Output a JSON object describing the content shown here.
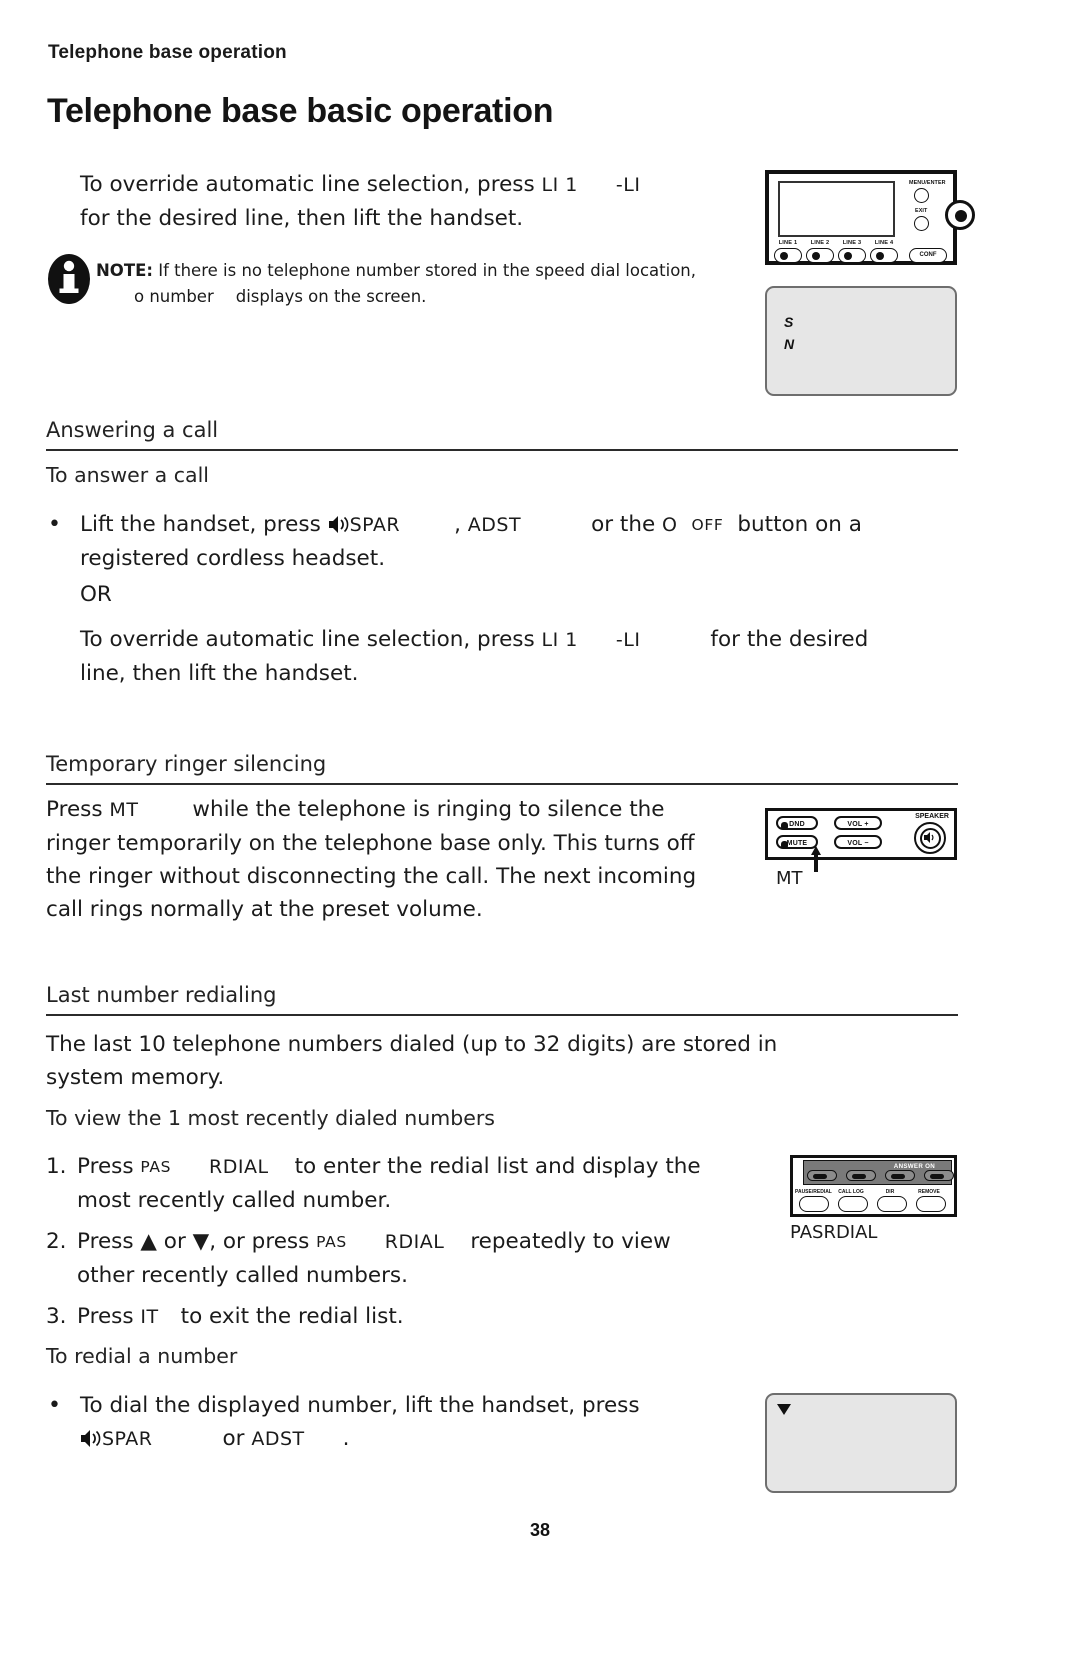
{
  "running_head": "Telephone base operation",
  "page_title": "Telephone base basic operation",
  "folio": "38",
  "intro": {
    "line1_a": "To override automatic line selection, press ",
    "line1_key1": "LI 1",
    "line1_key2": "-LI",
    "line2": "for the desired line, then lift the handset."
  },
  "note": {
    "icon": "info-icon",
    "label": "NOTE:",
    "text": " If there is no telephone number stored in the speed dial location,",
    "line2_key": "o number",
    "line2_rest": "displays on the screen."
  },
  "answering": {
    "heading": "Answering a call",
    "subheading": "To answer a call",
    "bullet_marker": "•",
    "bullet_a": "Lift the handset, press ",
    "bullet_key1": "SPAR",
    "bullet_mid1": ", ",
    "bullet_key2": "ADST",
    "bullet_mid2": "or the ",
    "bullet_key3": "O",
    "bullet_key4": "OFF",
    "bullet_end": "button on a",
    "bullet_line2": "registered cordless headset.",
    "or_label": "OR",
    "override_a": "To override automatic line selection, press ",
    "override_key1": "LI 1",
    "override_key2": "-LI",
    "override_end": "for the desired",
    "override_line2": "line, then lift the handset."
  },
  "ringer": {
    "heading": "Temporary ringer silencing",
    "press_label": "Press ",
    "key": "MT",
    "line1_rest": "while the telephone is ringing to silence the",
    "line2": "ringer temporarily on the telephone base only. This turns off",
    "line3": "the ringer without disconnecting the call. The next incoming",
    "line4": "call rings normally at the preset volume."
  },
  "redialing": {
    "heading": "Last number redialing",
    "intro_line1": "The last 10 telephone numbers dialed (up to 32 digits) are stored in",
    "intro_line2": "system memory.",
    "subheading": "To view the 1 most recently dialed numbers",
    "steps": [
      {
        "num": "1.",
        "a": "Press ",
        "key1": "PAS",
        "key2": "RDIAL",
        "rest": "to enter the redial list and display the",
        "line2": "most recently called number."
      },
      {
        "num": "2.",
        "a": "Press ",
        "up": "▲",
        "mid": " or ",
        "down": "▼",
        "mid2": ", or press ",
        "key1": "PAS",
        "key2": "RDIAL",
        "rest": "repeatedly to view",
        "line2": "other recently called numbers."
      },
      {
        "num": "3.",
        "a": "Press ",
        "key1": "IT",
        "rest": "to exit the redial list."
      }
    ],
    "redial_sub": "To redial a number",
    "redial_bullet_marker": "•",
    "redial_bullet_line1": "To dial the displayed number, lift the handset, press",
    "redial_key1": "SPAR",
    "redial_mid": "or ",
    "redial_key2": "ADST",
    "redial_end": "."
  },
  "graphics": {
    "top_device": {
      "name": "telephone-base-line-buttons",
      "line_labels": [
        "LINE 1",
        "LINE 2",
        "LINE 3",
        "LINE 4"
      ],
      "right_labels": [
        "MENU/ENTER",
        "EXIT"
      ],
      "conf_label": "CONF"
    },
    "screen_capture_1": {
      "name": "lcd-screen-capture",
      "lines": [
        "S",
        "N"
      ]
    },
    "mute_device": {
      "name": "telephone-base-mute-panel",
      "buttons": [
        "DND",
        "MUTE",
        "VOL +",
        "VOL −"
      ],
      "speaker_label": "SPEAKER",
      "callout": "MT"
    },
    "redial_device": {
      "name": "telephone-base-redial-panel",
      "banner": "ANSWER ON",
      "labels": [
        "PAUSE/REDIAL",
        "CALL LOG",
        "DIR",
        "REMOVE"
      ],
      "callout": "PASRDIAL"
    },
    "screen_capture_2": {
      "name": "lcd-screen-capture-2",
      "icon": "triangle-down-icon"
    }
  },
  "colors": {
    "text": "#1b1b1b",
    "rule": "#2b2b2b",
    "capture_bg": "#e6e6e6",
    "capture_border": "#6e6e6e",
    "device_band": "#7a7a7a"
  }
}
